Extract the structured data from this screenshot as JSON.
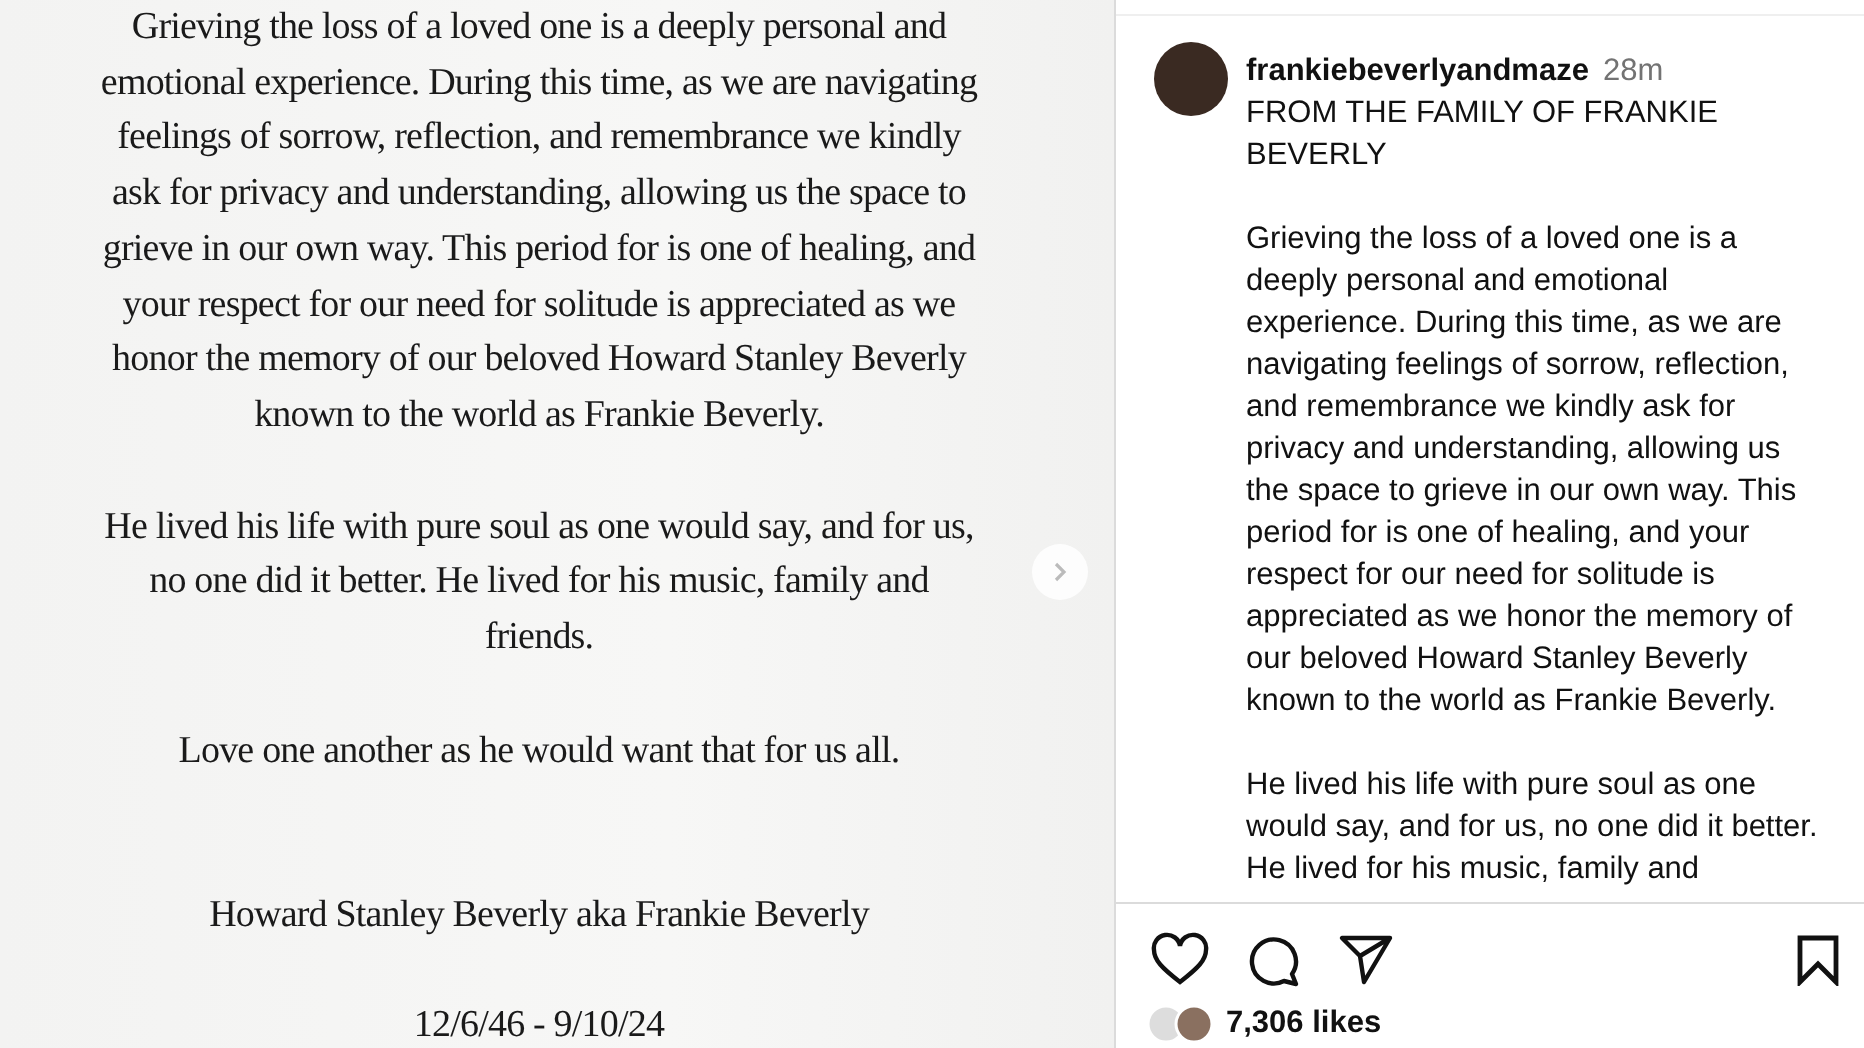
{
  "statement": {
    "paragraphs": [
      [
        "Grieving the loss of a loved one is a deeply personal and",
        "emotional experience. During this time, as we are navigating",
        "feelings of sorrow, reflection, and remembrance we kindly",
        "ask for privacy and understanding, allowing us the space to",
        "grieve in our own way. This period for is one of healing, and",
        "your respect for our need for solitude is appreciated as we",
        "honor the memory of our beloved Howard Stanley Beverly",
        "known to the world as Frankie Beverly."
      ],
      [
        "He lived his life with pure soul as one would say, and for us,",
        "no one did it better. He lived for his music, family and",
        "friends."
      ],
      [
        "Love one another as he would want that for us all."
      ],
      [
        "Howard Stanley Beverly aka Frankie Beverly"
      ],
      [
        "12/6/46 - 9/10/24"
      ]
    ]
  },
  "post": {
    "username": "frankiebeverlyandmaze",
    "time": "28m",
    "title": "FROM THE FAMILY OF FRANKIE BEVERLY",
    "caption": [
      "Grieving the loss of a loved one is a deeply personal and emotional experience. During this time, as we are navigating feelings of sorrow, reflection, and remembrance we kindly ask for privacy and understanding, allowing us the space to grieve in our own way. This period for is one of healing, and your respect for our need for solitude is appreciated as we honor the memory of our beloved Howard Stanley Beverly known to the world as Frankie Beverly.",
      "He lived his life with pure soul as one would say, and for us, no one did it better. He lived for his music, family and"
    ],
    "likes": "7,306 likes"
  }
}
